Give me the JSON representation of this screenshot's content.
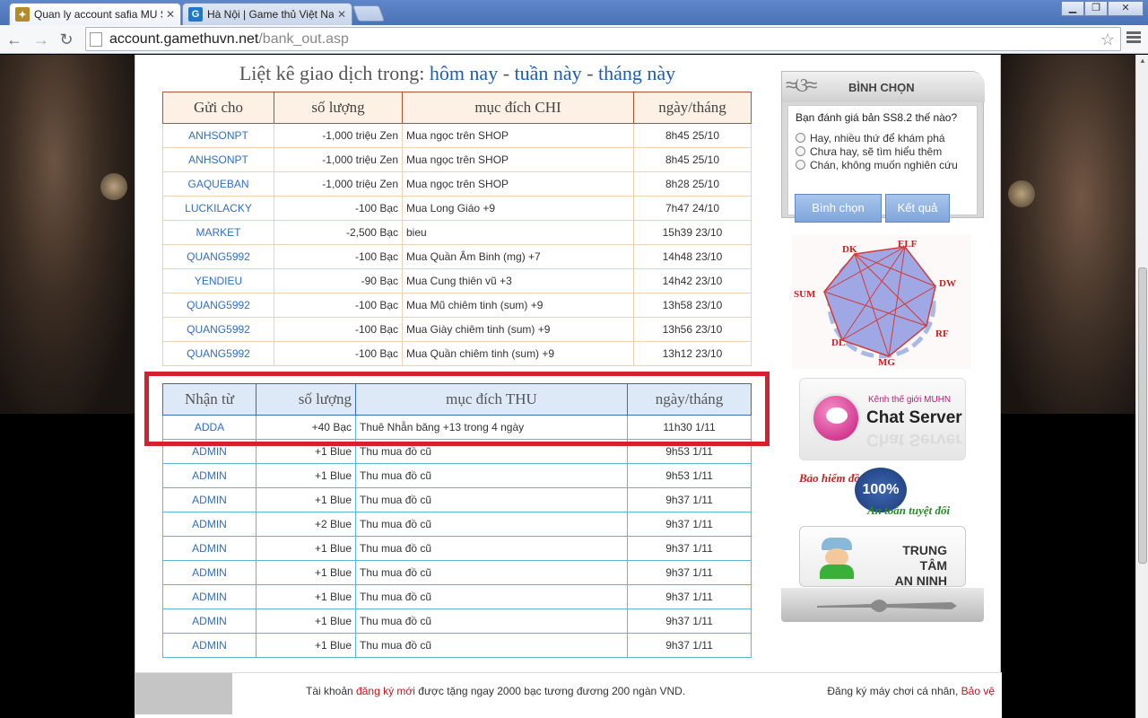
{
  "browser": {
    "tabs": [
      {
        "title": "Quan ly account safia MU SS"
      },
      {
        "title": "Hà Nội | Game thủ Việt Nam"
      }
    ],
    "url_host": "account.gamethuvn.net",
    "url_path": "/bank_out.asp"
  },
  "listing": {
    "prefix": "Liệt kê giao dịch trong: ",
    "today": "hôm nay",
    "sep1": " - ",
    "week": "tuần này",
    "sep2": " - ",
    "month": "tháng này"
  },
  "chi_table": {
    "headers": [
      "Gửi cho",
      "số lượng",
      "mục đích CHI",
      "ngày/tháng"
    ],
    "rows": [
      {
        "name": "ANHSONPT",
        "amount": "-1,000  triệu Zen",
        "purpose": "Mua ngọc trên SHOP",
        "date": "8h45 25/10"
      },
      {
        "name": "ANHSONPT",
        "amount": "-1,000  triệu Zen",
        "purpose": "Mua ngọc trên SHOP",
        "date": "8h45 25/10"
      },
      {
        "name": "GAQUEBAN",
        "amount": "-1,000  triệu Zen",
        "purpose": "Mua ngọc trên SHOP",
        "date": "8h28 25/10"
      },
      {
        "name": "LUCKILACKY",
        "amount": "-100  Bạc",
        "purpose": "Mua Long Giáo +9",
        "date": "7h47 24/10"
      },
      {
        "name": "MARKET",
        "amount": "-2,500  Bạc",
        "purpose": "bieu",
        "date": "15h39 23/10"
      },
      {
        "name": "QUANG5992",
        "amount": "-100  Bạc",
        "purpose": "Mua Quần Âm Binh (mg) +7",
        "date": "14h48 23/10"
      },
      {
        "name": "YENDIEU",
        "amount": "-90  Bạc",
        "purpose": "Mua Cung thiên vũ +3",
        "date": "14h42 23/10"
      },
      {
        "name": "QUANG5992",
        "amount": "-100  Bạc",
        "purpose": "Mua Mũ chiêm tinh (sum) +9",
        "date": "13h58 23/10"
      },
      {
        "name": "QUANG5992",
        "amount": "-100  Bạc",
        "purpose": "Mua Giày chiêm tinh (sum) +9",
        "date": "13h56 23/10"
      },
      {
        "name": "QUANG5992",
        "amount": "-100  Bạc",
        "purpose": "Mua Quần chiêm tinh (sum) +9",
        "date": "13h12 23/10"
      }
    ]
  },
  "thu_table": {
    "headers": [
      "Nhận từ",
      "số lượng",
      "mục đích THU",
      "ngày/tháng"
    ],
    "rows": [
      {
        "name": "ADDA",
        "amount": "+40  Bạc",
        "purpose": "Thuê Nhẫn băng +13 trong 4 ngày",
        "date": "11h30 1/11"
      },
      {
        "name": "ADMIN",
        "amount": "+1  Blue",
        "purpose": "Thu mua đồ cũ",
        "date": "9h53 1/11"
      },
      {
        "name": "ADMIN",
        "amount": "+1  Blue",
        "purpose": "Thu mua đồ cũ",
        "date": "9h53 1/11"
      },
      {
        "name": "ADMIN",
        "amount": "+1  Blue",
        "purpose": "Thu mua đồ cũ",
        "date": "9h37 1/11"
      },
      {
        "name": "ADMIN",
        "amount": "+2  Blue",
        "purpose": "Thu mua đồ cũ",
        "date": "9h37 1/11"
      },
      {
        "name": "ADMIN",
        "amount": "+1  Blue",
        "purpose": "Thu mua đồ cũ",
        "date": "9h37 1/11"
      },
      {
        "name": "ADMIN",
        "amount": "+1  Blue",
        "purpose": "Thu mua đồ cũ",
        "date": "9h37 1/11"
      },
      {
        "name": "ADMIN",
        "amount": "+1  Blue",
        "purpose": "Thu mua đồ cũ",
        "date": "9h37 1/11"
      },
      {
        "name": "ADMIN",
        "amount": "+1  Blue",
        "purpose": "Thu mua đồ cũ",
        "date": "9h37 1/11"
      },
      {
        "name": "ADMIN",
        "amount": "+1  Blue",
        "purpose": "Thu mua đồ cũ",
        "date": "9h37 1/11"
      }
    ]
  },
  "poll": {
    "title": "BÌNH CHỌN",
    "question": "Bạn đánh giá bản SS8.2 thế nào?",
    "options": [
      "Hay, nhiều thứ để khám phá",
      "Chưa hay, sẽ tìm hiểu thêm",
      "Chán, không muốn nghiên cứu"
    ],
    "vote_label": "Bình chọn",
    "result_label": "Kết quả"
  },
  "class_diagram": {
    "labels": [
      "DK",
      "ELF",
      "DW",
      "RF",
      "MG",
      "DL",
      "SUM"
    ]
  },
  "chat_banner": {
    "subtitle": "Kênh thế giới MUHN",
    "title": "Chat Server"
  },
  "insurance": {
    "line1": "Bảo hiểm đồ",
    "seal": "100%",
    "line2": "An toàn tuyệt đối"
  },
  "security": {
    "line1": "TRUNG TÂM",
    "line2": "AN NINH"
  },
  "footer": {
    "part1": "Tài khoản ",
    "link1": "đăng ký mới",
    "part2": " được tặng ngay 2000 bạc tương đương 200 ngàn VND.",
    "right_text": "Đăng ký máy chơi cá nhân, ",
    "right_link": "Bảo vệ"
  },
  "colors": {
    "link": "#2f6fc1",
    "chi_header_border": "#b2512e",
    "thu_header_bg": "#dde9f7",
    "highlight": "#d8202c"
  }
}
